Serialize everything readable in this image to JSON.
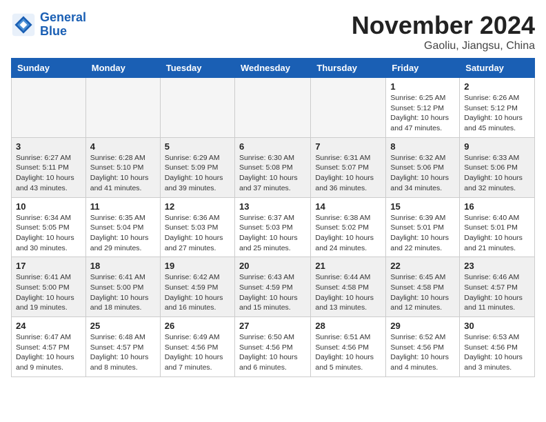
{
  "header": {
    "logo_line1": "General",
    "logo_line2": "Blue",
    "month_year": "November 2024",
    "location": "Gaoliu, Jiangsu, China"
  },
  "weekdays": [
    "Sunday",
    "Monday",
    "Tuesday",
    "Wednesday",
    "Thursday",
    "Friday",
    "Saturday"
  ],
  "weeks": [
    {
      "shaded": false,
      "days": [
        {
          "num": "",
          "info": ""
        },
        {
          "num": "",
          "info": ""
        },
        {
          "num": "",
          "info": ""
        },
        {
          "num": "",
          "info": ""
        },
        {
          "num": "",
          "info": ""
        },
        {
          "num": "1",
          "info": "Sunrise: 6:25 AM\nSunset: 5:12 PM\nDaylight: 10 hours\nand 47 minutes."
        },
        {
          "num": "2",
          "info": "Sunrise: 6:26 AM\nSunset: 5:12 PM\nDaylight: 10 hours\nand 45 minutes."
        }
      ]
    },
    {
      "shaded": true,
      "days": [
        {
          "num": "3",
          "info": "Sunrise: 6:27 AM\nSunset: 5:11 PM\nDaylight: 10 hours\nand 43 minutes."
        },
        {
          "num": "4",
          "info": "Sunrise: 6:28 AM\nSunset: 5:10 PM\nDaylight: 10 hours\nand 41 minutes."
        },
        {
          "num": "5",
          "info": "Sunrise: 6:29 AM\nSunset: 5:09 PM\nDaylight: 10 hours\nand 39 minutes."
        },
        {
          "num": "6",
          "info": "Sunrise: 6:30 AM\nSunset: 5:08 PM\nDaylight: 10 hours\nand 37 minutes."
        },
        {
          "num": "7",
          "info": "Sunrise: 6:31 AM\nSunset: 5:07 PM\nDaylight: 10 hours\nand 36 minutes."
        },
        {
          "num": "8",
          "info": "Sunrise: 6:32 AM\nSunset: 5:06 PM\nDaylight: 10 hours\nand 34 minutes."
        },
        {
          "num": "9",
          "info": "Sunrise: 6:33 AM\nSunset: 5:06 PM\nDaylight: 10 hours\nand 32 minutes."
        }
      ]
    },
    {
      "shaded": false,
      "days": [
        {
          "num": "10",
          "info": "Sunrise: 6:34 AM\nSunset: 5:05 PM\nDaylight: 10 hours\nand 30 minutes."
        },
        {
          "num": "11",
          "info": "Sunrise: 6:35 AM\nSunset: 5:04 PM\nDaylight: 10 hours\nand 29 minutes."
        },
        {
          "num": "12",
          "info": "Sunrise: 6:36 AM\nSunset: 5:03 PM\nDaylight: 10 hours\nand 27 minutes."
        },
        {
          "num": "13",
          "info": "Sunrise: 6:37 AM\nSunset: 5:03 PM\nDaylight: 10 hours\nand 25 minutes."
        },
        {
          "num": "14",
          "info": "Sunrise: 6:38 AM\nSunset: 5:02 PM\nDaylight: 10 hours\nand 24 minutes."
        },
        {
          "num": "15",
          "info": "Sunrise: 6:39 AM\nSunset: 5:01 PM\nDaylight: 10 hours\nand 22 minutes."
        },
        {
          "num": "16",
          "info": "Sunrise: 6:40 AM\nSunset: 5:01 PM\nDaylight: 10 hours\nand 21 minutes."
        }
      ]
    },
    {
      "shaded": true,
      "days": [
        {
          "num": "17",
          "info": "Sunrise: 6:41 AM\nSunset: 5:00 PM\nDaylight: 10 hours\nand 19 minutes."
        },
        {
          "num": "18",
          "info": "Sunrise: 6:41 AM\nSunset: 5:00 PM\nDaylight: 10 hours\nand 18 minutes."
        },
        {
          "num": "19",
          "info": "Sunrise: 6:42 AM\nSunset: 4:59 PM\nDaylight: 10 hours\nand 16 minutes."
        },
        {
          "num": "20",
          "info": "Sunrise: 6:43 AM\nSunset: 4:59 PM\nDaylight: 10 hours\nand 15 minutes."
        },
        {
          "num": "21",
          "info": "Sunrise: 6:44 AM\nSunset: 4:58 PM\nDaylight: 10 hours\nand 13 minutes."
        },
        {
          "num": "22",
          "info": "Sunrise: 6:45 AM\nSunset: 4:58 PM\nDaylight: 10 hours\nand 12 minutes."
        },
        {
          "num": "23",
          "info": "Sunrise: 6:46 AM\nSunset: 4:57 PM\nDaylight: 10 hours\nand 11 minutes."
        }
      ]
    },
    {
      "shaded": false,
      "days": [
        {
          "num": "24",
          "info": "Sunrise: 6:47 AM\nSunset: 4:57 PM\nDaylight: 10 hours\nand 9 minutes."
        },
        {
          "num": "25",
          "info": "Sunrise: 6:48 AM\nSunset: 4:57 PM\nDaylight: 10 hours\nand 8 minutes."
        },
        {
          "num": "26",
          "info": "Sunrise: 6:49 AM\nSunset: 4:56 PM\nDaylight: 10 hours\nand 7 minutes."
        },
        {
          "num": "27",
          "info": "Sunrise: 6:50 AM\nSunset: 4:56 PM\nDaylight: 10 hours\nand 6 minutes."
        },
        {
          "num": "28",
          "info": "Sunrise: 6:51 AM\nSunset: 4:56 PM\nDaylight: 10 hours\nand 5 minutes."
        },
        {
          "num": "29",
          "info": "Sunrise: 6:52 AM\nSunset: 4:56 PM\nDaylight: 10 hours\nand 4 minutes."
        },
        {
          "num": "30",
          "info": "Sunrise: 6:53 AM\nSunset: 4:56 PM\nDaylight: 10 hours\nand 3 minutes."
        }
      ]
    }
  ]
}
